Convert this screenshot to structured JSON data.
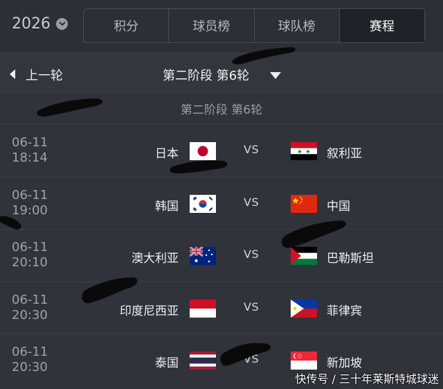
{
  "header": {
    "year": "2026",
    "tabs": [
      {
        "label": "积分"
      },
      {
        "label": "球员榜"
      },
      {
        "label": "球队榜"
      },
      {
        "label": "赛程"
      }
    ],
    "active_tab": "赛程"
  },
  "round_nav": {
    "prev_label": "上一轮",
    "current_round": "第二阶段 第6轮"
  },
  "section": {
    "title": "第二阶段 第6轮"
  },
  "matches": [
    {
      "date": "06-11",
      "time": "18:14",
      "home": "日本",
      "home_flag": "japan-flag",
      "vs": "VS",
      "away": "叙利亚",
      "away_flag": "syria-flag"
    },
    {
      "date": "06-11",
      "time": "19:00",
      "home": "韩国",
      "home_flag": "korea-flag",
      "vs": "VS",
      "away": "中国",
      "away_flag": "china-flag"
    },
    {
      "date": "06-11",
      "time": "20:10",
      "home": "澳大利亚",
      "home_flag": "australia-flag",
      "vs": "VS",
      "away": "巴勒斯坦",
      "away_flag": "palestine-flag"
    },
    {
      "date": "06-11",
      "time": "20:30",
      "home": "印度尼西亚",
      "home_flag": "indonesia-flag",
      "vs": "VS",
      "away": "菲律宾",
      "away_flag": "philippines-flag"
    },
    {
      "date": "06-11",
      "time": "20:30",
      "home": "泰国",
      "home_flag": "thailand-flag",
      "vs": "VS",
      "away": "新加坡",
      "away_flag": "singapore-flag"
    }
  ],
  "watermark": "快传号 / 三十年莱斯特城球迷",
  "colors": {
    "background": "#2f3237",
    "active_tab_bg": "#1f2226",
    "text_primary": "#eef0f2",
    "text_secondary": "#9fa3a9"
  }
}
